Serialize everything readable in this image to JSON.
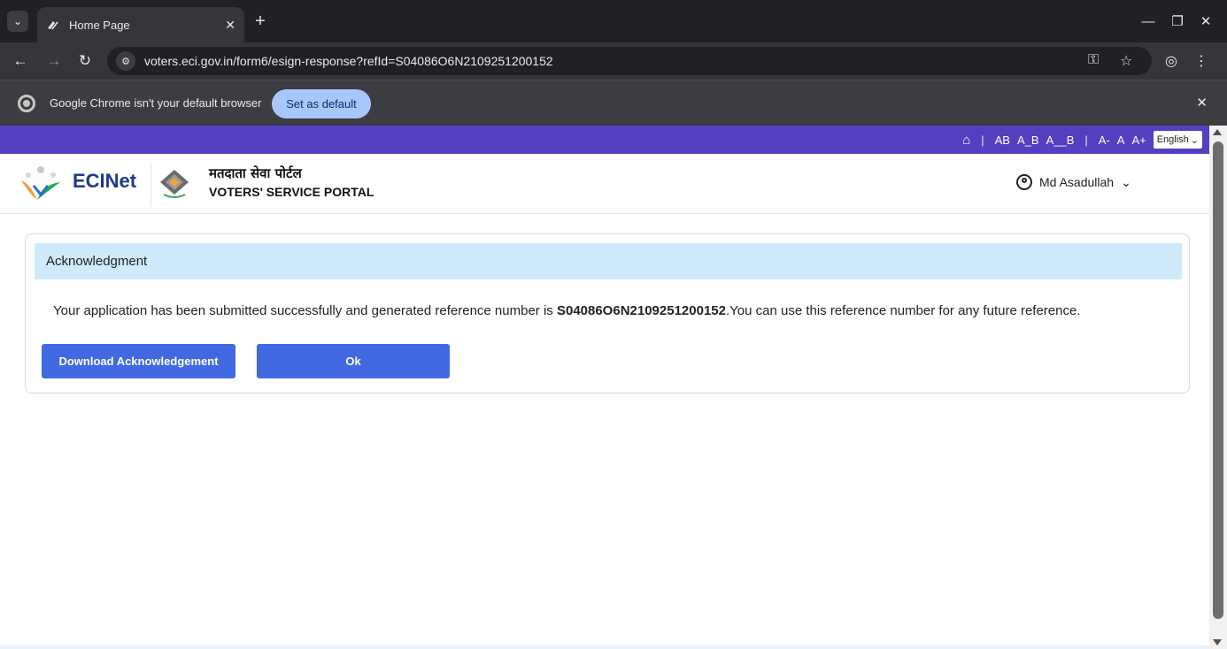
{
  "browser": {
    "tab_title": "Home Page",
    "url": "voters.eci.gov.in/form6/esign-response?refId=S04086O6N2109251200152",
    "infobar_message": "Google Chrome isn't your default browser",
    "infobar_button": "Set as default"
  },
  "topstrip": {
    "sep1": "|",
    "ab": "AB",
    "ab_underline": "A_B",
    "ab_double": "A__B",
    "sep2": "|",
    "font_minus": "A-",
    "font_normal": "A",
    "font_plus": "A+",
    "language": "English"
  },
  "header": {
    "brand": "ECINet",
    "portal_hindi": "मतदाता सेवा पोर्टल",
    "portal_english": "VOTERS' SERVICE PORTAL",
    "user_name": "Md Asadullah"
  },
  "acknowledgment": {
    "title": "Acknowledgment",
    "message_prefix": "Your application has been submitted successfully and generated reference number is ",
    "reference_number": "S04086O6N2109251200152",
    "message_suffix": ".You can use this reference number for any future reference.",
    "download_button": "Download Acknowledgement",
    "ok_button": "Ok"
  },
  "colors": {
    "topstrip": "#5340c0",
    "card_header": "#cfeafb",
    "primary_button": "#4169e1",
    "brand_text": "#1e3a8a"
  }
}
